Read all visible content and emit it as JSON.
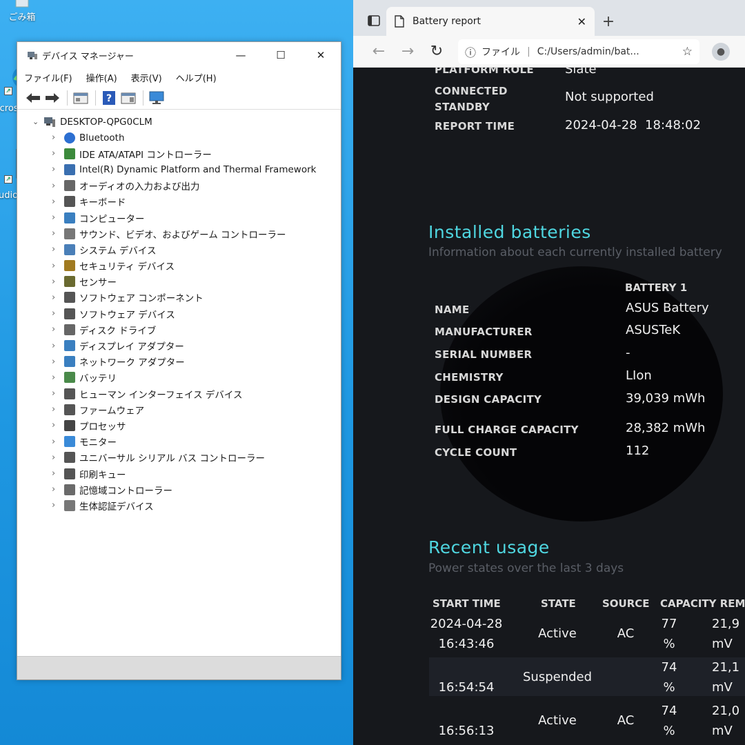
{
  "desktop": {
    "icons": [
      {
        "label": "ごみ箱"
      },
      {
        "label": "icrosof"
      },
      {
        "label": "udioV"
      }
    ]
  },
  "device_manager": {
    "title": "デバイス マネージャー",
    "menu": [
      "ファイル(F)",
      "操作(A)",
      "表示(V)",
      "ヘルプ(H)"
    ],
    "root": "DESKTOP-QPG0CLM",
    "items": [
      {
        "label": "Bluetooth",
        "icon": "bluetooth-icon"
      },
      {
        "label": "IDE ATA/ATAPI コントローラー",
        "icon": "ide-controller-icon"
      },
      {
        "label": "Intel(R) Dynamic Platform and Thermal Framework",
        "icon": "thermal-framework-icon"
      },
      {
        "label": "オーディオの入力および出力",
        "icon": "speaker-icon"
      },
      {
        "label": "キーボード",
        "icon": "keyboard-icon"
      },
      {
        "label": "コンピューター",
        "icon": "computer-icon"
      },
      {
        "label": "サウンド、ビデオ、およびゲーム コントローラー",
        "icon": "sound-icon"
      },
      {
        "label": "システム デバイス",
        "icon": "system-device-icon"
      },
      {
        "label": "セキュリティ デバイス",
        "icon": "security-device-icon"
      },
      {
        "label": "センサー",
        "icon": "sensor-icon"
      },
      {
        "label": "ソフトウェア コンポーネント",
        "icon": "software-component-icon"
      },
      {
        "label": "ソフトウェア デバイス",
        "icon": "software-device-icon"
      },
      {
        "label": "ディスク ドライブ",
        "icon": "disk-drive-icon"
      },
      {
        "label": "ディスプレイ アダプター",
        "icon": "display-adapter-icon"
      },
      {
        "label": "ネットワーク アダプター",
        "icon": "network-adapter-icon"
      },
      {
        "label": "バッテリ",
        "icon": "battery-icon"
      },
      {
        "label": "ヒューマン インターフェイス デバイス",
        "icon": "hid-icon"
      },
      {
        "label": "ファームウェア",
        "icon": "firmware-icon"
      },
      {
        "label": "プロセッサ",
        "icon": "processor-icon"
      },
      {
        "label": "モニター",
        "icon": "monitor-icon"
      },
      {
        "label": "ユニバーサル シリアル バス コントローラー",
        "icon": "usb-icon"
      },
      {
        "label": "印刷キュー",
        "icon": "print-queue-icon"
      },
      {
        "label": "記憶域コントローラー",
        "icon": "storage-controller-icon"
      },
      {
        "label": "生体認証デバイス",
        "icon": "biometric-icon"
      }
    ]
  },
  "browser": {
    "tab_title": "Battery report",
    "address_label": "ファイル",
    "url": "C:/Users/admin/bat..."
  },
  "report": {
    "system_info": [
      {
        "label": "PLATFORM ROLE",
        "value": "Slate"
      },
      {
        "label": "CONNECTED STANDBY",
        "value": "Not supported"
      },
      {
        "label": "REPORT TIME",
        "value": "2024-04-28  18:48:02"
      }
    ],
    "installed": {
      "title": "Installed batteries",
      "subtitle": "Information about each currently installed battery",
      "column": "BATTERY 1",
      "rows": [
        {
          "label": "NAME",
          "value": "ASUS Battery"
        },
        {
          "label": "MANUFACTURER",
          "value": "ASUSTeK"
        },
        {
          "label": "SERIAL NUMBER",
          "value": "-"
        },
        {
          "label": "CHEMISTRY",
          "value": "LIon"
        },
        {
          "label": "DESIGN CAPACITY",
          "value": "39,039 mWh"
        },
        {
          "label": "FULL CHARGE CAPACITY",
          "value": "28,382 mWh"
        },
        {
          "label": "CYCLE COUNT",
          "value": "112"
        }
      ]
    },
    "recent": {
      "title": "Recent usage",
      "subtitle": "Power states over the last 3 days",
      "headers": [
        "START TIME",
        "STATE",
        "SOURCE",
        "CAPACITY REM"
      ],
      "rows": [
        {
          "date": "2024-04-28",
          "time": "16:43:46",
          "state": "Active",
          "source": "AC",
          "pct": "77",
          "pct_unit": "%",
          "mwh": "21,9",
          "mwh_unit": "mV"
        },
        {
          "date": "",
          "time": "16:54:54",
          "state": "Suspended",
          "source": "",
          "pct": "74",
          "pct_unit": "%",
          "mwh": "21,1",
          "mwh_unit": "mV"
        },
        {
          "date": "",
          "time": "16:56:13",
          "state": "Active",
          "source": "AC",
          "pct": "74",
          "pct_unit": "%",
          "mwh": "21,0",
          "mwh_unit": "mV"
        }
      ]
    }
  }
}
